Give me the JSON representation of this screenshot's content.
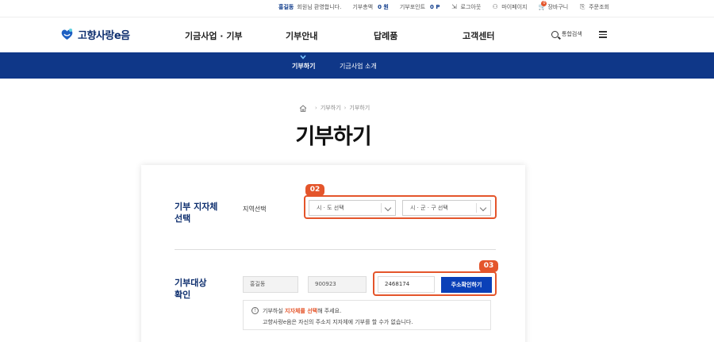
{
  "utility": {
    "user_name": "홍길동",
    "greeting": "회원님 환영합니다.",
    "donation_total_label": "기부총액",
    "donation_total_value": "0 원",
    "donation_points_label": "기부포인트",
    "donation_points_value": "0 P",
    "logout": "로그아웃",
    "mypage": "마이페이지",
    "cart": "장바구니",
    "cart_count": "0",
    "order_lookup": "주문조회"
  },
  "header": {
    "logo_text": "고향사랑e음",
    "nav": [
      "기금사업 · 기부",
      "기부안내",
      "답례품",
      "고객센터"
    ],
    "search_label": "통합검색"
  },
  "subnav": {
    "items": [
      "기부하기",
      "기금사업 소개"
    ],
    "active_index": 0
  },
  "breadcrumb": [
    "기부하기",
    "기부하기"
  ],
  "page_title": "기부하기",
  "form": {
    "section1": {
      "label_line1": "기부 지자체",
      "label_line2": "선택",
      "field_label": "지역선택",
      "select_sido_placeholder": "시 · 도 선택",
      "select_sigungu_placeholder": "시 · 군 · 구 선택",
      "callout_badge": "02"
    },
    "section2": {
      "label_line1": "기부대상",
      "label_line2": "확인",
      "name_value": "홍길동",
      "birth_value": "900923",
      "address_code_value": "2468174",
      "verify_button": "주소확인하기",
      "callout_badge": "03"
    },
    "notice": {
      "line1_prefix": "기부하실 ",
      "line1_highlight": "지자체를 선택",
      "line1_suffix": "해 주세요.",
      "line2": "고향사랑e음은 자신의 주소지 지자체에 기부를 할 수가 없습니다."
    }
  },
  "colors": {
    "navy": "#0f3788",
    "accent_orange": "#e4552b",
    "button_blue": "#0a40b8"
  }
}
